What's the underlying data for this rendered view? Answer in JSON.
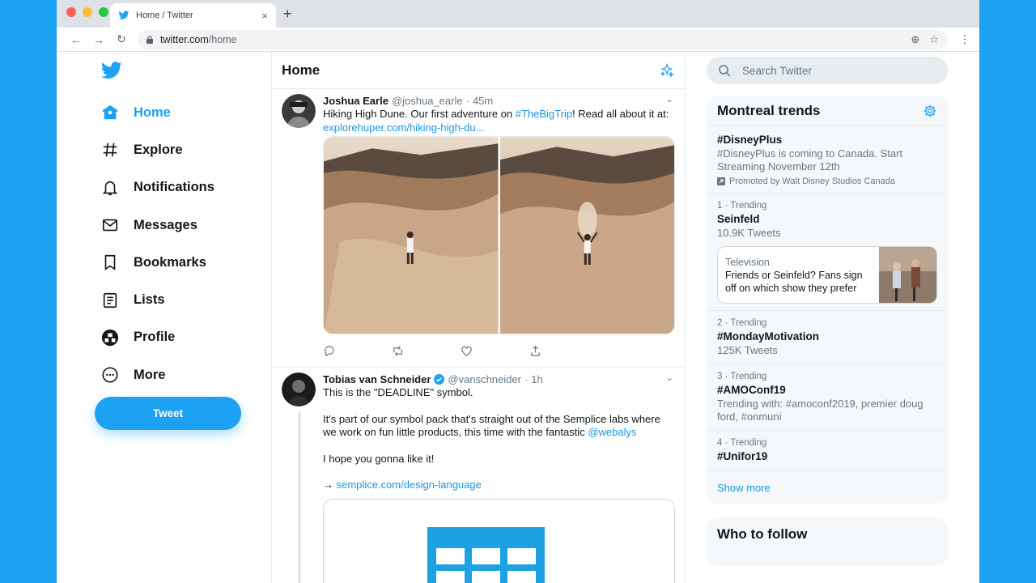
{
  "browser": {
    "tab_title": "Home / Twitter",
    "tab_close": "×",
    "new_tab": "+",
    "url_host": "twitter.com",
    "url_path": "/home"
  },
  "nav": {
    "items": [
      {
        "label": "Home",
        "icon": "home-icon"
      },
      {
        "label": "Explore",
        "icon": "hashtag-icon"
      },
      {
        "label": "Notifications",
        "icon": "bell-icon"
      },
      {
        "label": "Messages",
        "icon": "envelope-icon"
      },
      {
        "label": "Bookmarks",
        "icon": "bookmark-icon"
      },
      {
        "label": "Lists",
        "icon": "list-icon"
      },
      {
        "label": "Profile",
        "icon": "avatar-icon"
      },
      {
        "label": "More",
        "icon": "more-icon"
      }
    ],
    "tweet_button": "Tweet"
  },
  "timeline": {
    "title": "Home",
    "tweets": [
      {
        "name": "Joshua Earle",
        "handle": "@joshua_earle",
        "sep": "·",
        "time": "45m",
        "text_before": "Hiking High Dune. Our first adventure on ",
        "hashtag": "#TheBigTrip",
        "text_after": "! Read all about it at:",
        "link": "explorehuper.com/hiking-high-du..."
      },
      {
        "name": "Tobias van Schneider",
        "handle": "@vanschneider",
        "sep": "·",
        "time": "1h",
        "line1": "This is the \"DEADLINE\" symbol.",
        "line2_before": "It's part of our symbol pack that's straight out of the Semplice labs where we work on fun little products, this time with the fantastic ",
        "line2_mention": "@webalys",
        "line3": "I hope you gonna like it!",
        "line4_arrow": "→ ",
        "line4_link": "semplice.com/design-language"
      }
    ]
  },
  "sidebar": {
    "search_placeholder": "Search Twitter",
    "trends_title": "Montreal trends",
    "promoted": {
      "name": "#DisneyPlus",
      "desc": "#DisneyPlus is coming to Canada. Start Streaming November 12th",
      "promo": "Promoted by Walt Disney Studios Canada"
    },
    "trends": [
      {
        "meta": "1 · Trending",
        "name": "Seinfeld",
        "count": "10.9K Tweets"
      },
      {
        "meta": "2 · Trending",
        "name": "#MondayMotivation",
        "count": "125K Tweets"
      },
      {
        "meta": "3 · Trending",
        "name": "#AMOConf19",
        "count": "Trending with: #amoconf2019, premier doug ford, #onmuni"
      },
      {
        "meta": "4 · Trending",
        "name": "#Unifor19",
        "count": ""
      }
    ],
    "tv_card": {
      "category": "Television",
      "headline": "Friends or Seinfeld? Fans sign off on which show they prefer"
    },
    "show_more": "Show more",
    "who_to_follow": "Who to follow"
  },
  "colors": {
    "brand": "#1da1f2",
    "link": "#1b95e0",
    "muted": "#657786"
  }
}
